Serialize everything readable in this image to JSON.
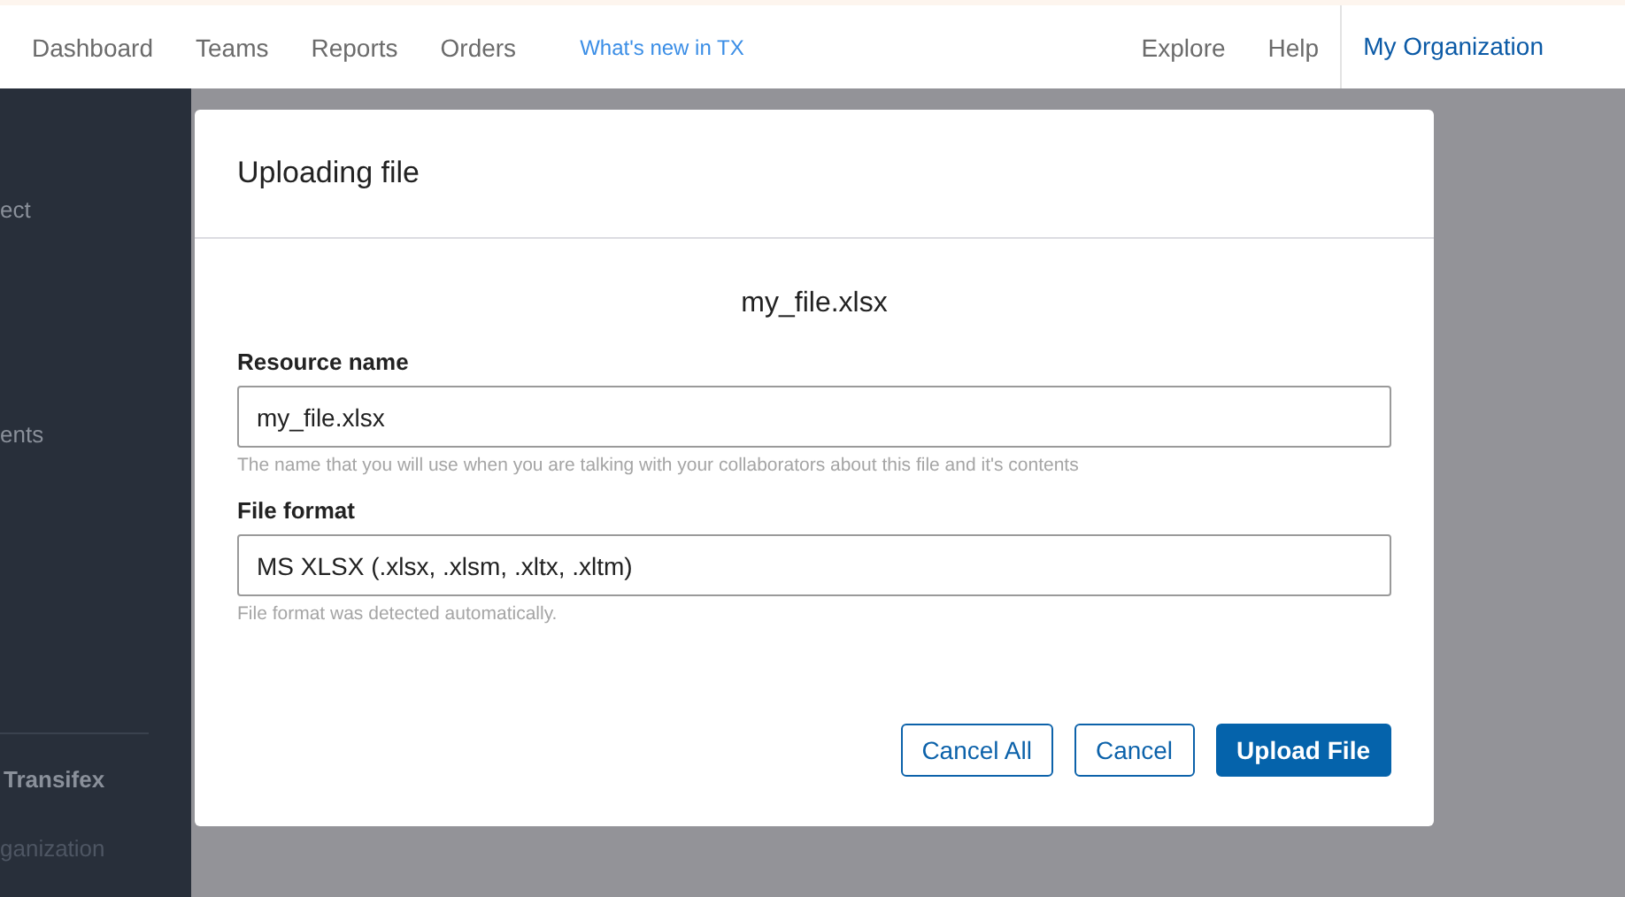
{
  "nav": {
    "items": [
      {
        "label": "Dashboard"
      },
      {
        "label": "Teams"
      },
      {
        "label": "Reports"
      },
      {
        "label": "Orders"
      }
    ],
    "whats_new": "What's new in TX",
    "right_items": [
      {
        "label": "Explore"
      },
      {
        "label": "Help"
      }
    ],
    "organization": "My Organization"
  },
  "sidebar": {
    "items": [
      {
        "label": "ect"
      },
      {
        "label": "ents"
      }
    ],
    "section_title": "Transifex",
    "section_item": "ganization"
  },
  "dialog": {
    "title": "Uploading file",
    "file_name": "my_file.xlsx",
    "fields": [
      {
        "label": "Resource name",
        "value": "my_file.xlsx",
        "hint": "The name that you will use when you are talking with your collaborators about this file and it's contents"
      },
      {
        "label": "File format",
        "value": "MS XLSX (.xlsx, .xlsm, .xltx, .xltm)",
        "hint": "File format was detected automatically."
      }
    ],
    "buttons": [
      {
        "label": "Cancel All",
        "kind": "secondary"
      },
      {
        "label": "Cancel",
        "kind": "secondary"
      },
      {
        "label": "Upload File",
        "kind": "primary"
      }
    ]
  }
}
